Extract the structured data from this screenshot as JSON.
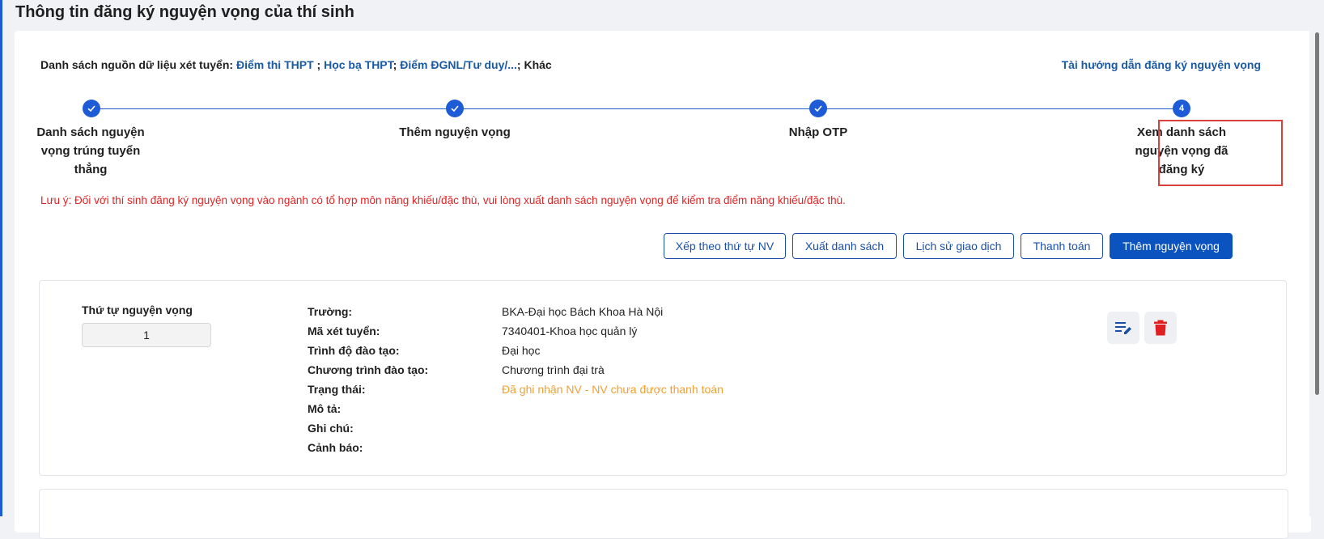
{
  "page": {
    "title": "Thông tin đăng ký nguyện vọng của thí sinh"
  },
  "sources": {
    "prefix": "Danh sách nguồn dữ liệu xét tuyển:",
    "link1": "Điểm thi THPT",
    "sep1": " ; ",
    "link2": "Học bạ THPT",
    "sep2": "; ",
    "link3": "Điểm ĐGNL/Tư duy/...",
    "sep3": "; ",
    "other": "Khác"
  },
  "guide_link": "Tài hướng dẫn đăng ký nguyện vọng",
  "stepper": {
    "steps": [
      {
        "label": "Danh sách nguyện vọng trúng tuyển thẳng",
        "state": "done"
      },
      {
        "label": "Thêm nguyện vọng",
        "state": "done"
      },
      {
        "label": "Nhập OTP",
        "state": "done"
      },
      {
        "label": "Xem danh sách nguyện vọng đã đăng ký",
        "state": "current",
        "number": "4"
      }
    ]
  },
  "notice": "Lưu ý: Đối với thí sinh đăng ký nguyện vọng vào ngành có tổ hợp môn năng khiếu/đặc thù, vui lòng xuất danh sách nguyện vọng để kiểm tra điểm năng khiếu/đặc thù.",
  "actions": {
    "sort": "Xếp theo thứ tự NV",
    "export": "Xuất danh sách",
    "history": "Lịch sử giao dịch",
    "pay": "Thanh toán",
    "add": "Thêm nguyện vọng"
  },
  "wish": {
    "order_label": "Thứ tự nguyện vọng",
    "order_value": "1",
    "fields": [
      {
        "label": "Trường:",
        "value": "BKA-Đại học Bách Khoa Hà Nội"
      },
      {
        "label": "Mã xét tuyển:",
        "value": "7340401-Khoa học quản lý"
      },
      {
        "label": "Trình độ đào tạo:",
        "value": "Đại học"
      },
      {
        "label": "Chương trình đào tạo:",
        "value": "Chương trình đại trà"
      },
      {
        "label": "Trạng thái:",
        "value": "Đã ghi nhận NV - NV chưa được thanh toán"
      },
      {
        "label": "Mô tả:",
        "value": ""
      },
      {
        "label": "Ghi chú:",
        "value": ""
      },
      {
        "label": "Cảnh báo:",
        "value": ""
      }
    ],
    "icons": {
      "edit": "edit-list-icon",
      "delete": "trash-icon"
    }
  },
  "colors": {
    "accent": "#1e5bd6",
    "link": "#1a5aa6",
    "warning": "#e12323",
    "status_pending": "#f0a030",
    "delete": "#e02020"
  }
}
